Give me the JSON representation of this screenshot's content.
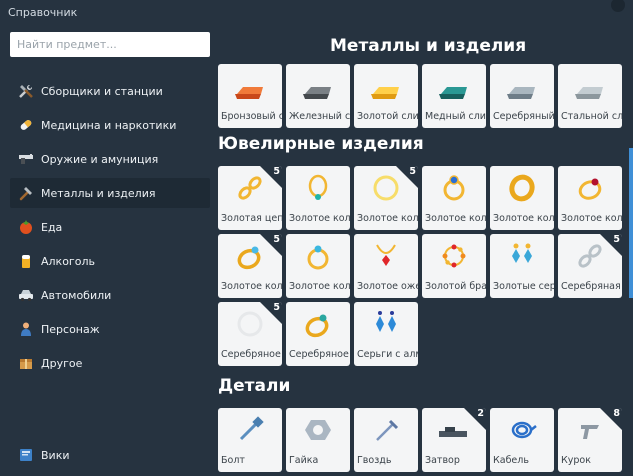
{
  "window": {
    "title": "Справочник"
  },
  "search": {
    "placeholder": "Найти предмет..."
  },
  "sidebar": {
    "items": [
      {
        "label": "Сборщики и станции",
        "icon": "tools-icon"
      },
      {
        "label": "Медицина и наркотики",
        "icon": "pill-icon"
      },
      {
        "label": "Оружие и амуниция",
        "icon": "gun-icon"
      },
      {
        "label": "Металлы и изделия",
        "icon": "hammer-icon",
        "active": true
      },
      {
        "label": "Еда",
        "icon": "tomato-icon"
      },
      {
        "label": "Алкоголь",
        "icon": "beer-icon"
      },
      {
        "label": "Автомобили",
        "icon": "car-icon"
      },
      {
        "label": "Персонаж",
        "icon": "person-icon"
      },
      {
        "label": "Другое",
        "icon": "box-icon"
      }
    ],
    "wiki": {
      "label": "Вики",
      "icon": "book-icon"
    }
  },
  "sections": {
    "metals": {
      "title": "Металлы и изделия",
      "items": [
        {
          "label": "Бронзовый слиток",
          "icon": "bronze-ingot-icon",
          "color": "#e0622c"
        },
        {
          "label": "Железный слиток",
          "icon": "iron-ingot-icon",
          "color": "#5d6266"
        },
        {
          "label": "Золотой слиток",
          "icon": "gold-ingot-icon",
          "color": "#f2b321"
        },
        {
          "label": "Медный слиток",
          "icon": "copper-ingot-icon",
          "color": "#1f7a78"
        },
        {
          "label": "Серебряный слиток",
          "icon": "silver-ingot-icon",
          "color": "#8fa0ab"
        },
        {
          "label": "Стальной слиток",
          "icon": "steel-ingot-icon",
          "color": "#a7b2b8"
        }
      ]
    },
    "jewelry": {
      "title": "Ювелирные изделия",
      "items": [
        {
          "label": "Золотая цепь",
          "icon": "gold-chain-icon",
          "badge": "5"
        },
        {
          "label": "Золотое колье",
          "icon": "gold-necklace-icon"
        },
        {
          "label": "Золотое кольцо",
          "icon": "gold-ring-icon",
          "badge": "5"
        },
        {
          "label": "Золотое кольцо с сапфиром",
          "icon": "gold-sapphire-ring-icon"
        },
        {
          "label": "Золотое кольцо",
          "icon": "gold-band-icon"
        },
        {
          "label": "Золотое кольцо с рубином",
          "icon": "gold-ruby-ring-icon"
        },
        {
          "label": "Золотое кольцо с бриллиантом",
          "icon": "gold-diamond-ring-icon",
          "badge": "5"
        },
        {
          "label": "Золотое кольцо с топазом",
          "icon": "gold-topaz-ring-icon"
        },
        {
          "label": "Золотое ожерелье",
          "icon": "gold-pendant-icon"
        },
        {
          "label": "Золотой браслет",
          "icon": "gold-bracelet-icon"
        },
        {
          "label": "Золотые серьги",
          "icon": "gold-earrings-icon"
        },
        {
          "label": "Серебряная цепь",
          "icon": "silver-chain-icon",
          "badge": "5"
        },
        {
          "label": "Серебряное кольцо",
          "icon": "silver-ring-icon",
          "badge": "5"
        },
        {
          "label": "Серебряное кольцо",
          "icon": "silver-gem-ring-icon"
        },
        {
          "label": "Серьги с алмазами",
          "icon": "diamond-earrings-icon"
        }
      ]
    },
    "parts": {
      "title": "Детали",
      "items": [
        {
          "label": "Болт",
          "icon": "bolt-icon"
        },
        {
          "label": "Гайка",
          "icon": "nut-icon"
        },
        {
          "label": "Гвоздь",
          "icon": "nail-icon"
        },
        {
          "label": "Затвор",
          "icon": "bolt-carrier-icon",
          "badge": "2"
        },
        {
          "label": "Кабель",
          "icon": "cable-icon"
        },
        {
          "label": "Курок",
          "icon": "trigger-icon",
          "badge": "8"
        }
      ]
    }
  }
}
